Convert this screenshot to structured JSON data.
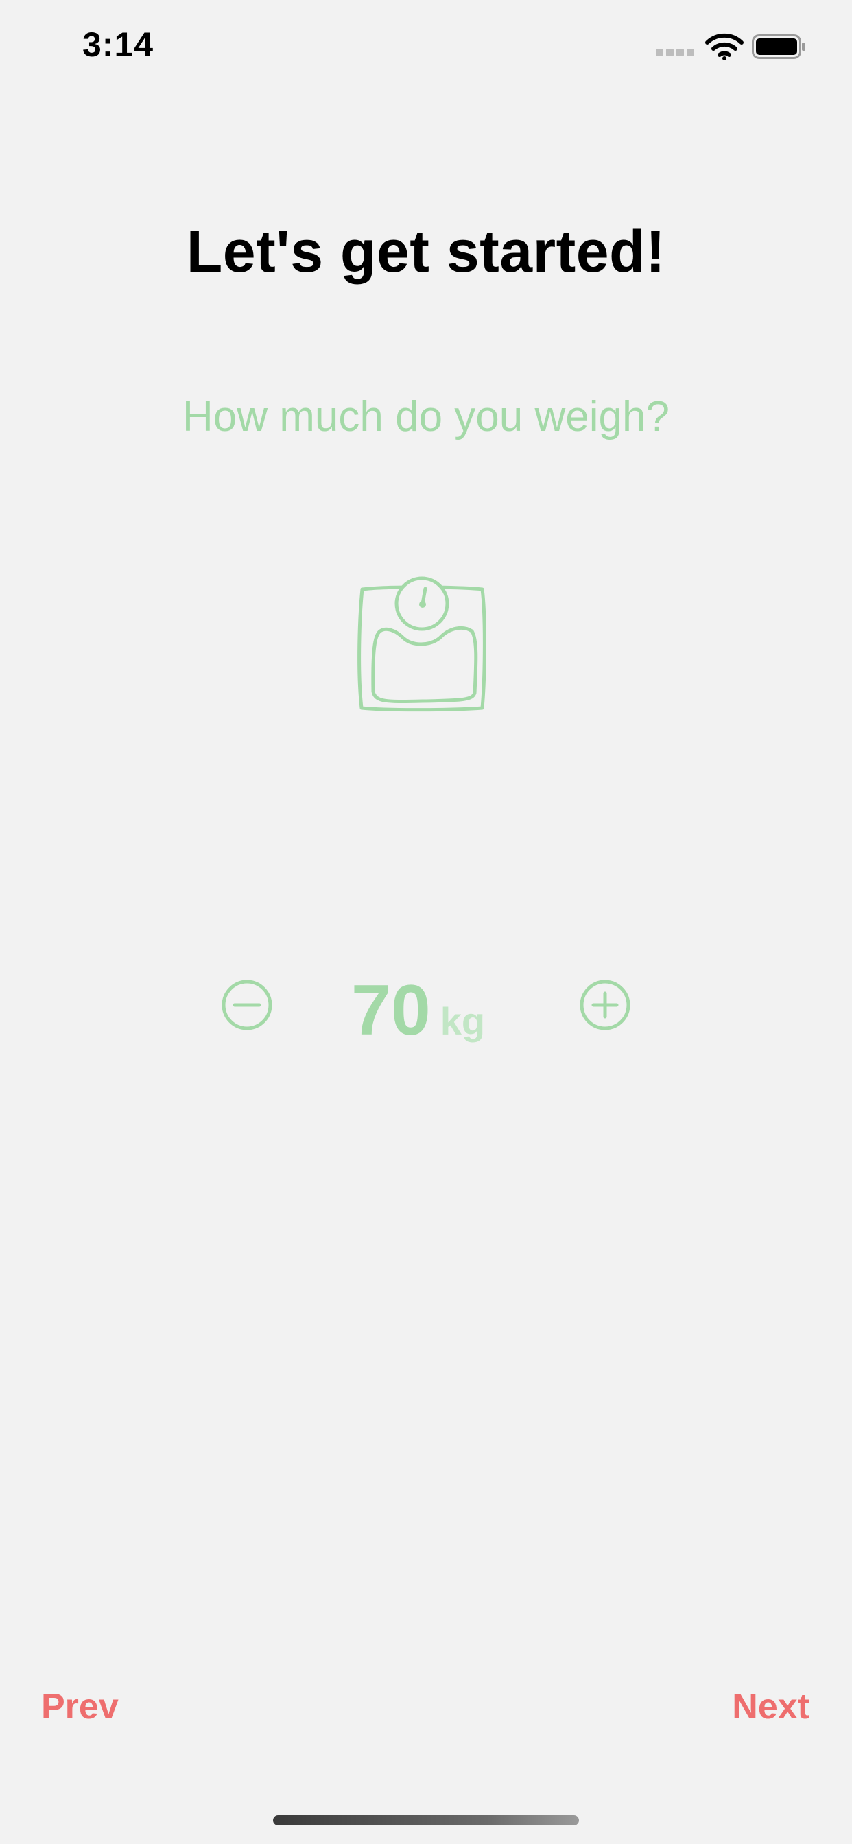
{
  "status_bar": {
    "time": "3:14",
    "signal_icon": "cellular-signal-icon",
    "wifi_icon": "wifi-icon",
    "battery_icon": "battery-icon"
  },
  "onboarding": {
    "title": "Let's get started!",
    "question": "How much do you weigh?",
    "illustration_icon": "weight-scale-icon",
    "accent_color": "#a3d9a7"
  },
  "weight_stepper": {
    "value": "70",
    "unit": "kg",
    "decrement_icon": "minus-circle-icon",
    "increment_icon": "plus-circle-icon"
  },
  "navigation": {
    "prev_label": "Prev",
    "next_label": "Next",
    "accent_color": "#ee6e6e"
  }
}
